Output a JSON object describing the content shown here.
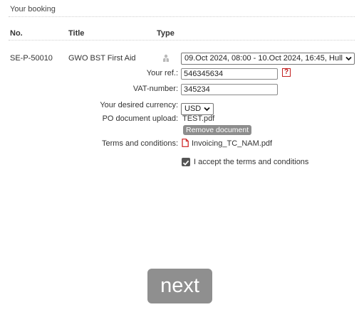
{
  "section_title": "Your booking",
  "table": {
    "headers": {
      "no": "No.",
      "title": "Title",
      "type": "Type"
    },
    "row": {
      "no": "SE-P-50010",
      "title": "GWO BST First Aid",
      "type_icon": "person-icon",
      "session_selected": "09.Oct 2024, 08:00 - 10.Oct 2024, 16:45, Hull"
    }
  },
  "form": {
    "your_ref": {
      "label": "Your ref.:",
      "value": "546345634",
      "help_icon": "?"
    },
    "vat": {
      "label": "VAT-number:",
      "value": "345234"
    },
    "currency": {
      "label": "Your desired currency:",
      "selected": "USD"
    },
    "po_upload": {
      "label": "PO document upload:",
      "file_name": "TEST.pdf",
      "remove_label": "Remove document"
    },
    "terms": {
      "label": "Terms and conditions:",
      "file_name": "Invoicing_TC_NAM.pdf",
      "icon": "pdf-icon"
    },
    "accept": {
      "label": "I accept the terms and conditions",
      "checked": true
    }
  },
  "next_label": "next"
}
